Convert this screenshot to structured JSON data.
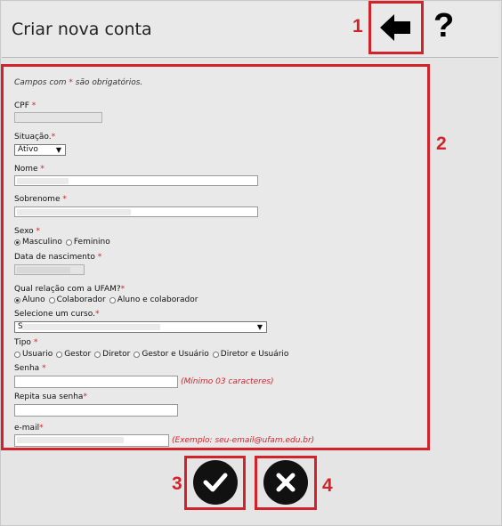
{
  "header": {
    "title": "Criar nova conta"
  },
  "markers": {
    "m1": "1",
    "m2": "2",
    "m3": "3",
    "m4": "4"
  },
  "icons": {
    "back": "arrow-left-icon",
    "help": "question-mark-icon",
    "confirm": "checkmark-icon",
    "cancel": "close-icon"
  },
  "help_glyph": "?",
  "form": {
    "required_note_prefix": "Campos com ",
    "required_star": "*",
    "required_note_suffix": " são obrigatórios.",
    "cpf_label": "CPF",
    "situacao_label": "Situação.",
    "situacao_value": "Ativo",
    "nome_label": "Nome",
    "sobrenome_label": "Sobrenome",
    "sexo_label": "Sexo",
    "sexo_options": [
      "Masculino",
      "Feminino"
    ],
    "nascimento_label": "Data de nascimento",
    "relacao_label": "Qual relação com a UFAM?",
    "relacao_options": [
      "Aluno",
      "Colaborador",
      "Aluno e colaborador"
    ],
    "curso_label": "Selecione um curso.",
    "curso_value": "S",
    "tipo_label": "Tipo",
    "tipo_options": [
      "Usuario",
      "Gestor",
      "Diretor",
      "Gestor e Usuário",
      "Diretor e Usuário"
    ],
    "senha_label": "Senha",
    "senha_hint": "(Mínimo 03 caracteres)",
    "repita_label": "Repita sua senha",
    "email_label": "e-mail",
    "email_hint": "(Exemplo: seu-email@ufam.edu.br)"
  },
  "colors": {
    "accent_red": "#d2232a",
    "background": "#e9e9e9"
  }
}
